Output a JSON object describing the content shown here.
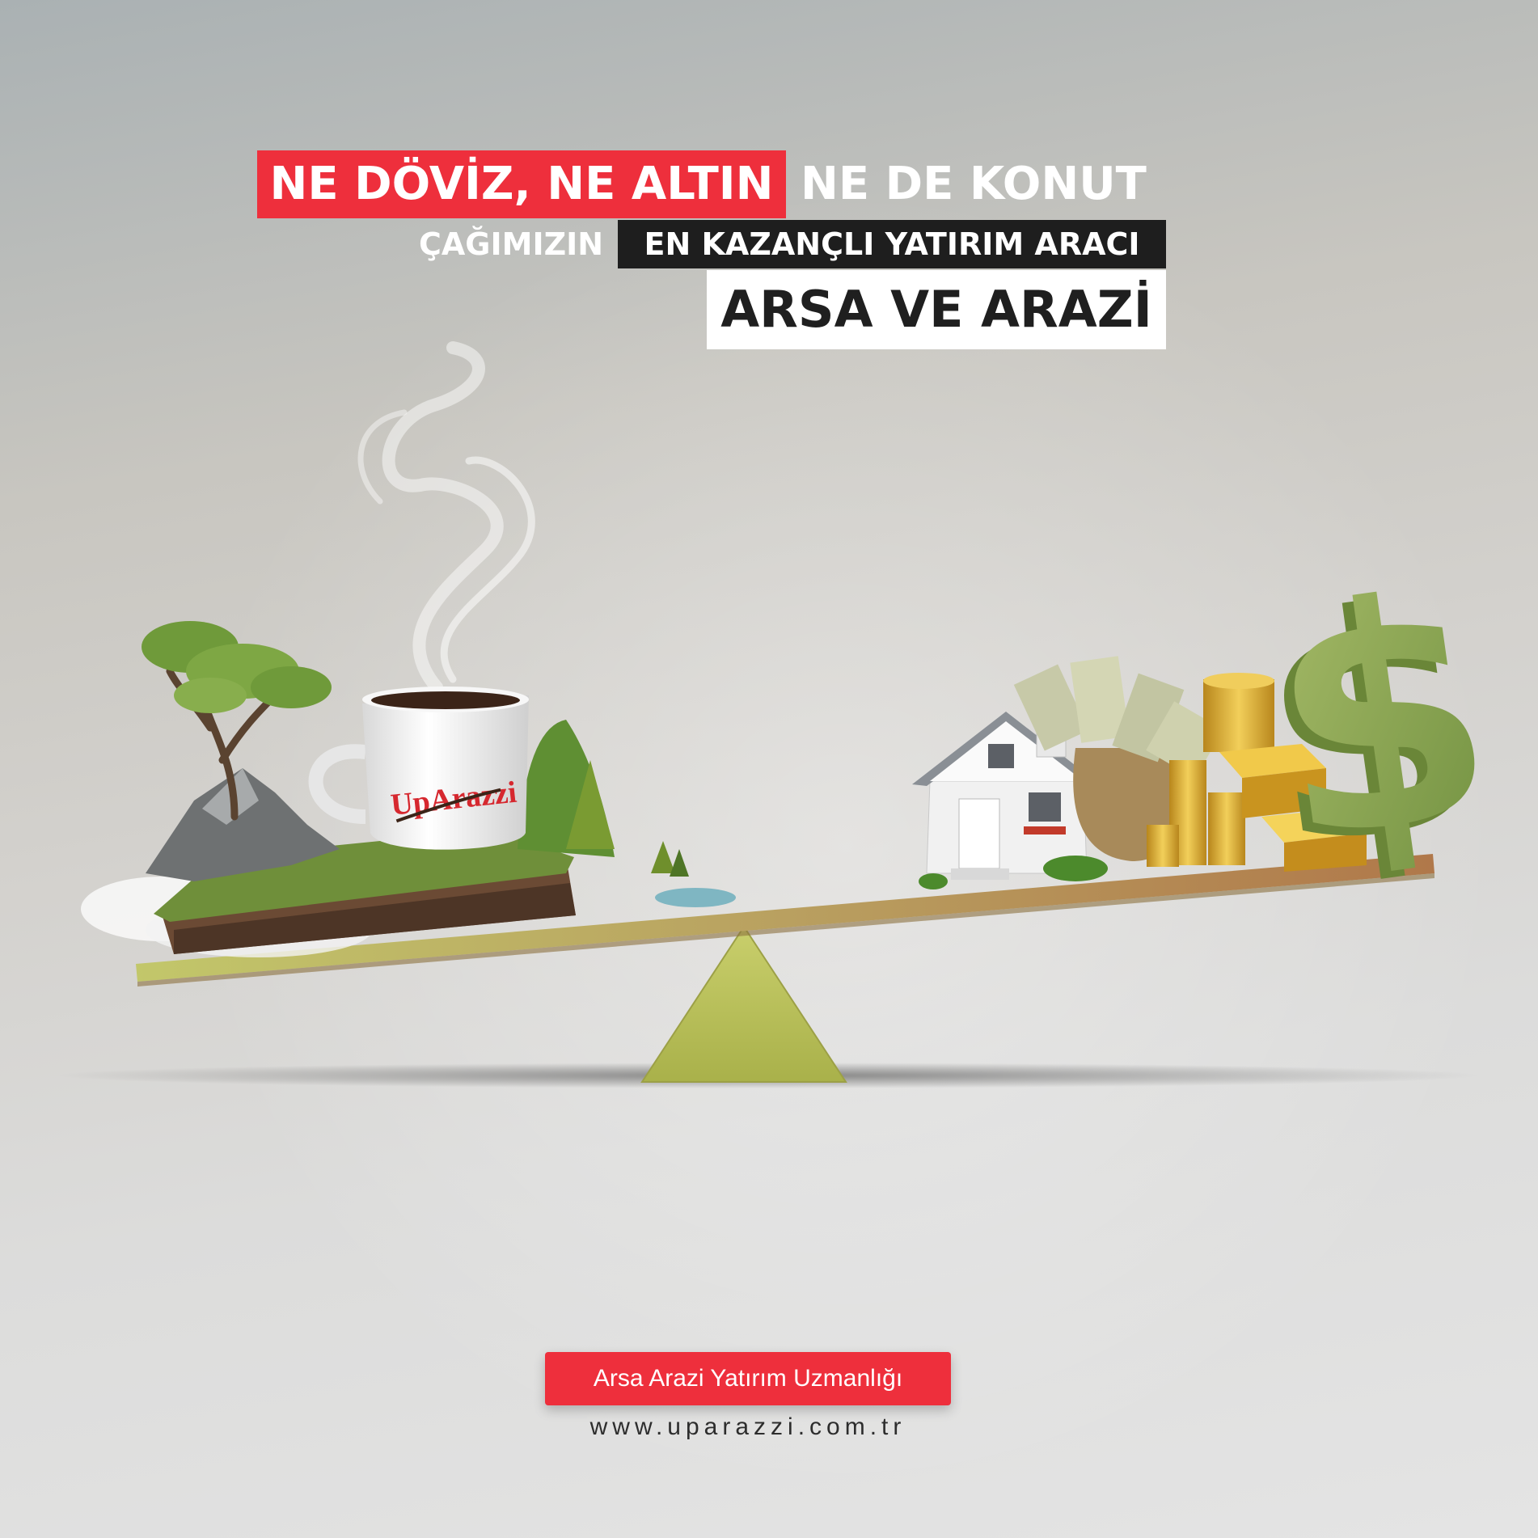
{
  "headline": {
    "line1_highlight": "NE DÖVİZ, NE ALTIN",
    "line1_rest": "NE DE KONUT",
    "line2_plain": "ÇAĞIMIZIN",
    "line2_highlight": "EN KAZANÇLI YATIRIM ARACI",
    "line3": "ARSA VE ARAZİ"
  },
  "mug": {
    "brand_logo": "UpArazzi"
  },
  "footer": {
    "badge": "Arsa Arazi Yatırım Uzmanlığı",
    "website": "www.uparazzi.com.tr"
  },
  "colors": {
    "brand_red": "#ee2f3c",
    "dark": "#1e1e1e",
    "scale_green": "#b5bf5a",
    "dollar_green": "#8faa56",
    "gold": "#d9a92c"
  }
}
